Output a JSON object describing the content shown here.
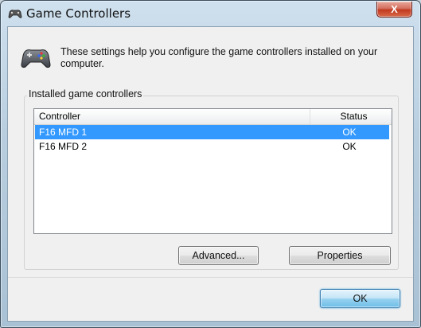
{
  "window": {
    "title": "Game Controllers",
    "close_label": "X",
    "title_icon": "game-controller-icon"
  },
  "header": {
    "icon": "game-controller-icon",
    "text": "These settings help you configure the game controllers installed on your computer."
  },
  "group": {
    "label": "Installed game controllers"
  },
  "list": {
    "columns": [
      "Controller",
      "Status"
    ],
    "rows": [
      {
        "name": "F16 MFD 1",
        "status": "OK",
        "selected": true
      },
      {
        "name": "F16 MFD 2",
        "status": "OK",
        "selected": false
      }
    ]
  },
  "buttons": {
    "advanced": "Advanced...",
    "properties": "Properties",
    "ok": "OK"
  },
  "colors": {
    "selection": "#3399ff",
    "close": "#c0391e"
  }
}
